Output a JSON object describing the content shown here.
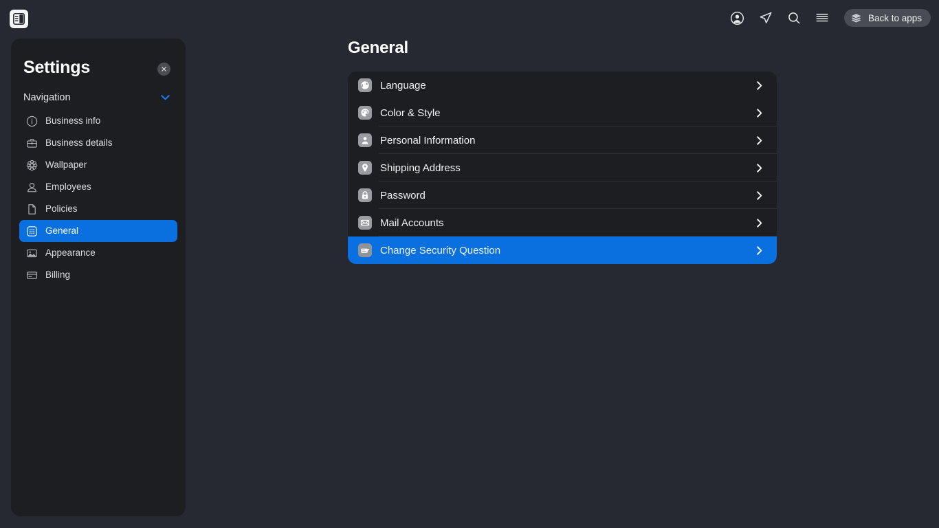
{
  "topbar": {
    "panel_toggle_icon": "sidebar-layout-icon",
    "icons": [
      {
        "name": "account-circle-icon",
        "glyph": "account"
      },
      {
        "name": "send-icon",
        "glyph": "send"
      },
      {
        "name": "search-icon",
        "glyph": "search"
      },
      {
        "name": "hamburger-menu-icon",
        "glyph": "menu"
      }
    ],
    "back_to_apps": {
      "label": "Back to apps",
      "icon": "layers-icon"
    }
  },
  "sidebar": {
    "title": "Settings",
    "close_icon": "close-icon",
    "nav_label": "Navigation",
    "nav_chevron_icon": "chevron-down-icon",
    "items": [
      {
        "label": "Business info",
        "icon": "info-circle-icon",
        "active": false
      },
      {
        "label": "Business details",
        "icon": "briefcase-icon",
        "active": false
      },
      {
        "label": "Wallpaper",
        "icon": "flower-icon",
        "active": false
      },
      {
        "label": "Employees",
        "icon": "person-icon",
        "active": false
      },
      {
        "label": "Policies",
        "icon": "document-icon",
        "active": false
      },
      {
        "label": "General",
        "icon": "grid-icon",
        "active": true
      },
      {
        "label": "Appearance",
        "icon": "image-icon",
        "active": false
      },
      {
        "label": "Billing",
        "icon": "credit-card-icon",
        "active": false
      }
    ]
  },
  "main": {
    "title": "General",
    "rows": [
      {
        "label": "Language",
        "icon": "globe-icon",
        "active": false,
        "separator": false
      },
      {
        "label": "Color & Style",
        "icon": "palette-icon",
        "active": false,
        "separator": true
      },
      {
        "label": "Personal Information",
        "icon": "person-icon",
        "active": false,
        "separator": true
      },
      {
        "label": "Shipping Address",
        "icon": "location-icon",
        "active": false,
        "separator": true
      },
      {
        "label": "Password",
        "icon": "lock-icon",
        "active": false,
        "separator": true
      },
      {
        "label": "Mail Accounts",
        "icon": "envelope-icon",
        "active": false,
        "separator": true
      },
      {
        "label": "Change Security Question",
        "icon": "form-edit-icon",
        "active": true,
        "separator": false
      }
    ],
    "row_arrow_icon": "chevron-right-icon"
  },
  "colors": {
    "page_background": "#262932",
    "panel_background": "#1d1e22",
    "card_background": "#1d1e21",
    "accent_blue": "#0a70e0",
    "text_primary": "#f1f2f4",
    "separator": "#2e2f33"
  }
}
